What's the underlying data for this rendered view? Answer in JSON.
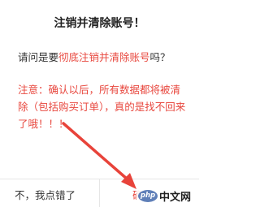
{
  "dialog": {
    "title": "注销并清除账号！",
    "question_prefix": "请问是要",
    "question_highlight": "彻底注销并清除账号",
    "question_suffix": "吗？",
    "warning": "注意：确认以后，所有数据都将被清除（包括购买订单），真的是找不回来了哦！！！"
  },
  "buttons": {
    "cancel_label": "不，我点错了",
    "confirm_label": "确定"
  },
  "watermark": {
    "logo_text": "php",
    "site_text": "中文网"
  },
  "colors": {
    "accent_red": "#e8483f",
    "text_dark": "#333333",
    "divider": "#e6e6e6"
  },
  "icons": {
    "annotation": "red-arrow-icon"
  }
}
